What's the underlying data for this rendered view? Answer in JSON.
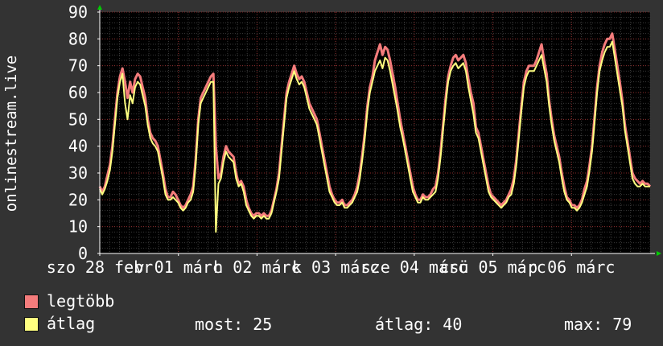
{
  "chart_data": {
    "type": "line",
    "ylabel": "onlinestream.live",
    "ylim": [
      0,
      90
    ],
    "yticks": [
      0,
      10,
      20,
      30,
      40,
      50,
      60,
      70,
      80,
      90
    ],
    "grid": true,
    "x_ticks": [
      {
        "label": "szo 28 febr",
        "pos": 0.0
      },
      {
        "label": "v 01 márc",
        "pos": 0.1429
      },
      {
        "label": "h 02 márc",
        "pos": 0.2857
      },
      {
        "label": "k 03 márc",
        "pos": 0.4286
      },
      {
        "label": "sze 04 márc",
        "pos": 0.5714
      },
      {
        "label": "csü 05 márc",
        "pos": 0.7143
      },
      {
        "label": "p 06 márc",
        "pos": 0.8571
      }
    ],
    "series": [
      {
        "name": "legtöbb",
        "color": "#f47c7c",
        "values": [
          25,
          23,
          25,
          29,
          33,
          40,
          50,
          60,
          66,
          69,
          64,
          58,
          64,
          60,
          65,
          67,
          66,
          62,
          58,
          50,
          45,
          43,
          42,
          40,
          35,
          30,
          24,
          21,
          21,
          23,
          22,
          20,
          18,
          17,
          18,
          20,
          22,
          25,
          35,
          50,
          58,
          60,
          62,
          64,
          66,
          67,
          40,
          28,
          30,
          36,
          40,
          38,
          37,
          36,
          30,
          26,
          27,
          25,
          20,
          17,
          15,
          14,
          15,
          15,
          14,
          15,
          14,
          14,
          16,
          20,
          24,
          30,
          40,
          50,
          60,
          64,
          67,
          70,
          67,
          65,
          66,
          64,
          60,
          56,
          54,
          52,
          50,
          45,
          40,
          35,
          30,
          25,
          22,
          20,
          19,
          19,
          20,
          18,
          18,
          19,
          20,
          22,
          25,
          30,
          37,
          45,
          55,
          62,
          66,
          72,
          75,
          78,
          74,
          77,
          76,
          72,
          67,
          62,
          56,
          50,
          45,
          40,
          35,
          30,
          25,
          22,
          20,
          20,
          22,
          21,
          21,
          22,
          24,
          25,
          30,
          38,
          48,
          58,
          66,
          70,
          73,
          74,
          72,
          73,
          74,
          71,
          65,
          60,
          56,
          47,
          45,
          40,
          35,
          30,
          25,
          22,
          21,
          20,
          19,
          18,
          19,
          20,
          22,
          24,
          28,
          35,
          45,
          55,
          64,
          68,
          70,
          70,
          70,
          72,
          75,
          78,
          72,
          67,
          57,
          50,
          44,
          40,
          36,
          30,
          25,
          21,
          20,
          18,
          18,
          17,
          18,
          20,
          24,
          27,
          33,
          40,
          51,
          62,
          70,
          75,
          78,
          80,
          80,
          82,
          76,
          70,
          64,
          57,
          48,
          42,
          36,
          30,
          28,
          27,
          26,
          27,
          26,
          26,
          25
        ],
        "legend_label": "legtöbb"
      },
      {
        "name": "átlag",
        "color": "#ffff80",
        "values": [
          24,
          22,
          24,
          27,
          31,
          38,
          48,
          58,
          64,
          67,
          56,
          50,
          59,
          56,
          62,
          64,
          63,
          59,
          55,
          48,
          43,
          41,
          40,
          38,
          33,
          28,
          22,
          20,
          20,
          21,
          20,
          19,
          17,
          16,
          17,
          19,
          20,
          23,
          33,
          48,
          56,
          58,
          60,
          62,
          64,
          64,
          8,
          26,
          28,
          34,
          38,
          36,
          35,
          34,
          28,
          25,
          26,
          23,
          18,
          16,
          14,
          13,
          14,
          14,
          13,
          14,
          13,
          13,
          15,
          19,
          23,
          28,
          38,
          48,
          58,
          62,
          65,
          68,
          65,
          63,
          64,
          62,
          58,
          54,
          52,
          50,
          48,
          43,
          38,
          33,
          28,
          23,
          21,
          19,
          18,
          18,
          19,
          17,
          17,
          18,
          19,
          21,
          23,
          28,
          35,
          43,
          53,
          60,
          64,
          68,
          70,
          72,
          69,
          73,
          72,
          68,
          63,
          58,
          53,
          47,
          43,
          38,
          33,
          28,
          23,
          21,
          19,
          19,
          21,
          20,
          20,
          21,
          22,
          23,
          28,
          36,
          46,
          56,
          64,
          68,
          70,
          71,
          69,
          70,
          71,
          68,
          62,
          57,
          52,
          45,
          43,
          38,
          33,
          28,
          23,
          21,
          20,
          19,
          18,
          17,
          18,
          19,
          21,
          22,
          26,
          33,
          43,
          53,
          62,
          66,
          68,
          68,
          68,
          70,
          72,
          74,
          69,
          64,
          55,
          48,
          42,
          38,
          34,
          28,
          23,
          20,
          19,
          17,
          17,
          16,
          17,
          19,
          22,
          25,
          31,
          38,
          49,
          60,
          68,
          72,
          75,
          77,
          77,
          79,
          73,
          67,
          61,
          55,
          46,
          40,
          34,
          28,
          26,
          25,
          25,
          26,
          25,
          25,
          25
        ],
        "legend_label": "átlag"
      }
    ],
    "stats": {
      "now_label": "most:",
      "now_value": "25",
      "avg_label": "átlag:",
      "avg_value": "40",
      "max_label": "max:",
      "max_value": "79"
    }
  },
  "colors": {
    "background": "#333333",
    "plot_bg": "#000000",
    "grid_minor": "#3a3a3a",
    "grid_major": "#8a2a2a",
    "axis": "#ffffff",
    "arrow": "#00cc00"
  }
}
